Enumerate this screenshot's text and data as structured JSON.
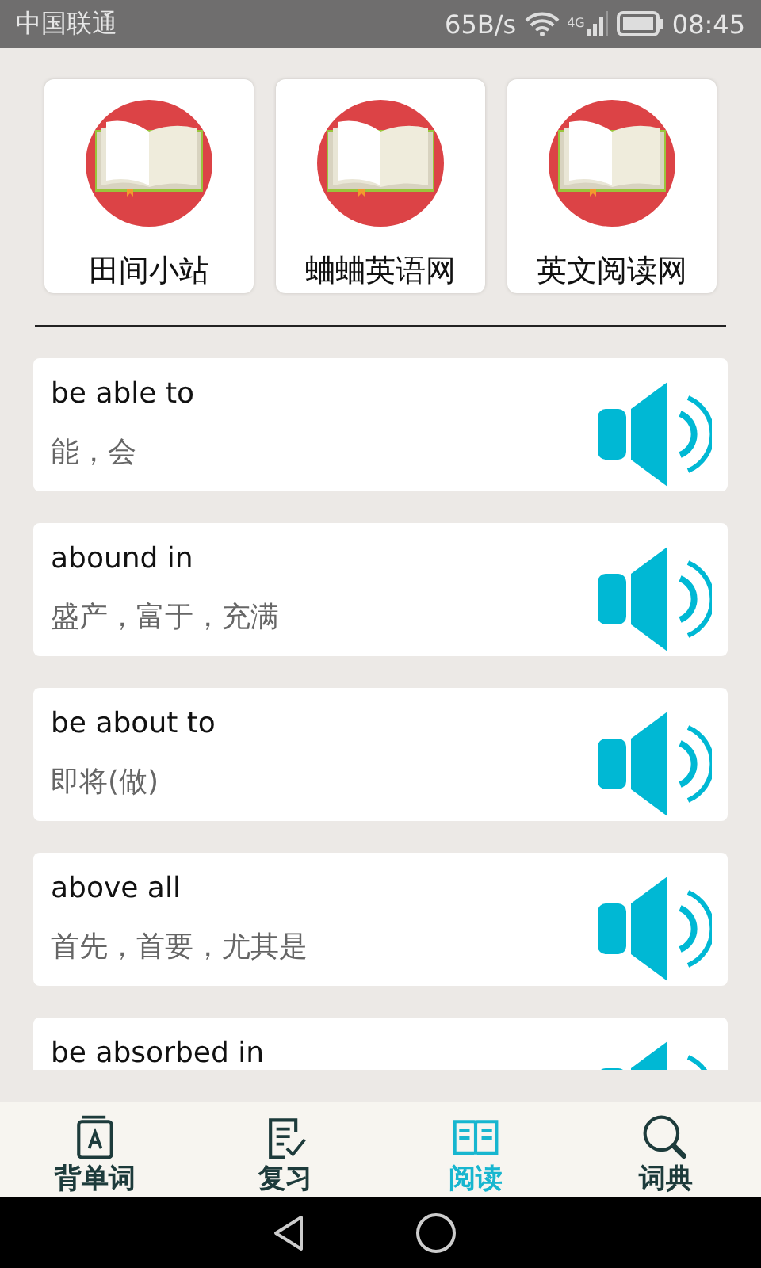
{
  "status_bar": {
    "carrier": "中国联通",
    "speed": "65B/s",
    "network": "4G",
    "time": "08:45"
  },
  "sites": [
    {
      "label": "田间小站"
    },
    {
      "label": "蛐蛐英语网"
    },
    {
      "label": "英文阅读网"
    }
  ],
  "phrases": [
    {
      "english": "be able to",
      "meaning": "能，会"
    },
    {
      "english": "abound in",
      "meaning": "盛产，富于，充满"
    },
    {
      "english": "be about to",
      "meaning": "即将(做)"
    },
    {
      "english": "above all",
      "meaning": "首先，首要，尤其是"
    },
    {
      "english": "be absorbed in"
    }
  ],
  "tabs": [
    {
      "kind": "words",
      "label": "背单词",
      "selected": false
    },
    {
      "kind": "review",
      "label": "复习",
      "selected": false
    },
    {
      "kind": "reading",
      "label": "阅读",
      "selected": true
    },
    {
      "kind": "dictionary",
      "label": "词典",
      "selected": false
    }
  ]
}
